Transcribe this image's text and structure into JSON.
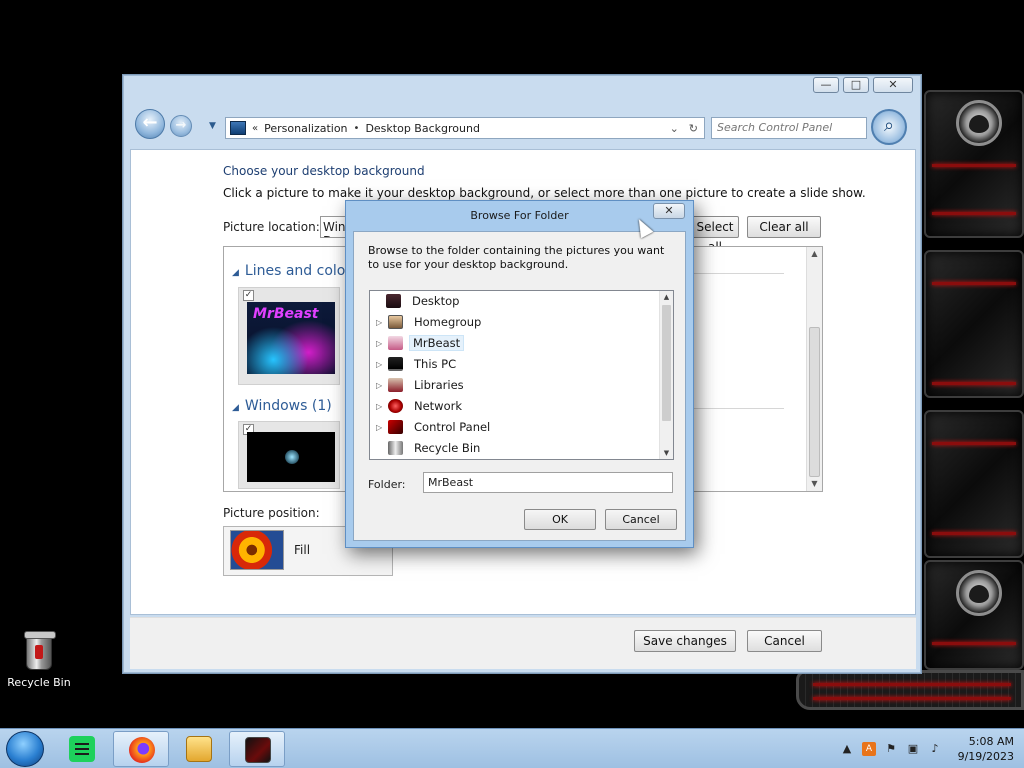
{
  "window": {
    "caption_minimize": "—",
    "caption_maximize": "□",
    "caption_close": "✕",
    "back_icon": "back-arrow-icon",
    "forward_icon": "forward-arrow-icon",
    "breadcrumb": {
      "root_chevron": "«",
      "items": [
        "Personalization",
        "Desktop Background"
      ],
      "separator": "•"
    },
    "search_placeholder": "Search Control Panel",
    "heading": "Choose your desktop background",
    "subheading": "Click a picture to make it your desktop background, or select more than one picture to create a slide show.",
    "picture_location_label": "Picture location:",
    "picture_location_value": "Windows Desktop Backgrounds",
    "select_all_label": "Select all",
    "clear_all_label": "Clear all",
    "groups": [
      {
        "title": "Lines and colors",
        "count": ""
      },
      {
        "title": "Windows (1)",
        "count": ""
      }
    ],
    "picture_position_label": "Picture position:",
    "picture_position_value": "Fill",
    "save_changes_label": "Save changes",
    "cancel_label": "Cancel"
  },
  "dialog": {
    "title": "Browse For Folder",
    "close": "✕",
    "description": "Browse to the folder containing the pictures you want to use for your desktop background.",
    "tree": [
      {
        "label": "Desktop",
        "icon": "desktop-icon",
        "expandable": false,
        "selected": false,
        "indent": 0
      },
      {
        "label": "Homegroup",
        "icon": "homegroup-icon",
        "expandable": true,
        "selected": false,
        "indent": 1
      },
      {
        "label": "MrBeast",
        "icon": "user-folder-icon",
        "expandable": true,
        "selected": true,
        "indent": 1
      },
      {
        "label": "This PC",
        "icon": "computer-icon",
        "expandable": true,
        "selected": false,
        "indent": 1
      },
      {
        "label": "Libraries",
        "icon": "libraries-icon",
        "expandable": true,
        "selected": false,
        "indent": 1
      },
      {
        "label": "Network",
        "icon": "network-icon",
        "expandable": true,
        "selected": false,
        "indent": 1
      },
      {
        "label": "Control Panel",
        "icon": "control-panel-icon",
        "expandable": true,
        "selected": false,
        "indent": 1
      },
      {
        "label": "Recycle Bin",
        "icon": "recycle-bin-icon",
        "expandable": false,
        "selected": false,
        "indent": 1
      }
    ],
    "folder_label": "Folder:",
    "folder_value": "MrBeast",
    "ok_label": "OK",
    "cancel_label": "Cancel"
  },
  "desktop": {
    "recycle_bin_label": "Recycle Bin"
  },
  "taskbar": {
    "pinned": [
      "notes-app-icon",
      "firefox-icon",
      "file-explorer-icon",
      "media-app-icon"
    ],
    "time": "5:08 AM",
    "date": "9/19/2023"
  },
  "colors": {
    "window_frame": "#c9dcef",
    "heading_blue": "#1e3f72",
    "gadget_red": "#e21d1d"
  }
}
